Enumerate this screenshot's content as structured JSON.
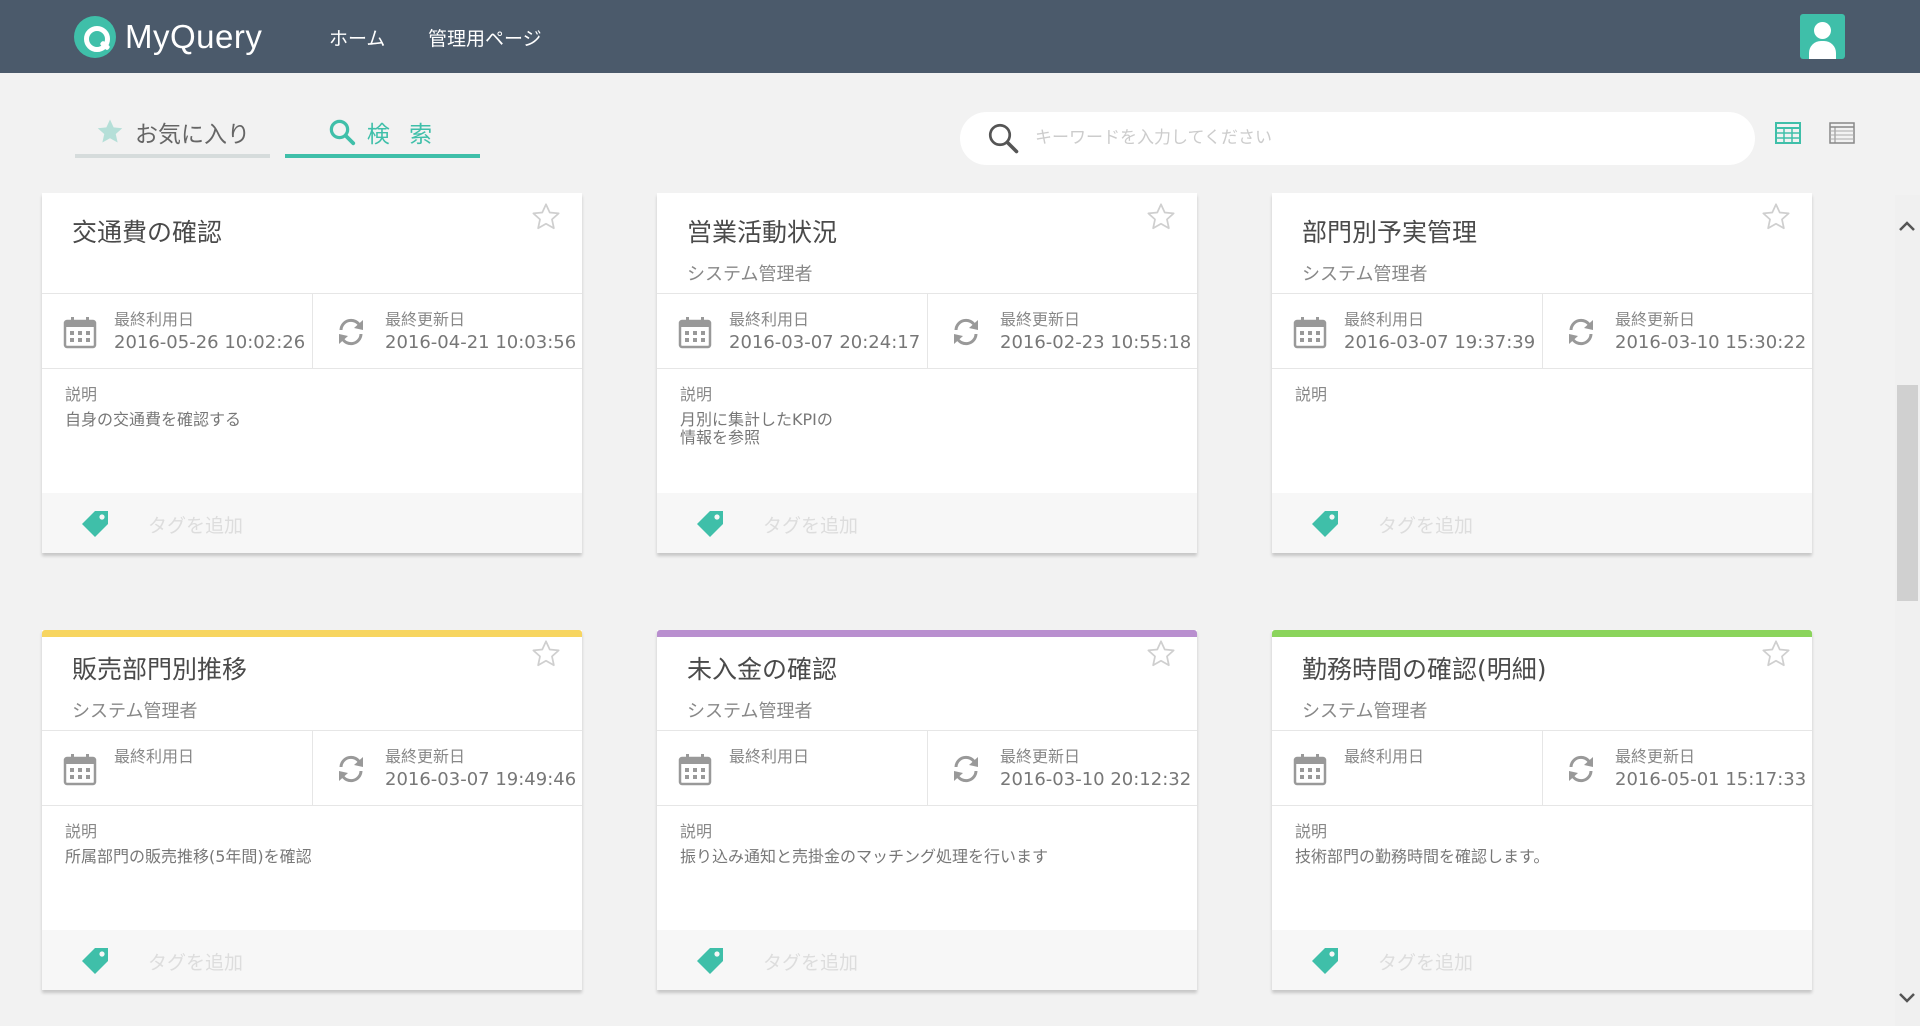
{
  "header": {
    "logo_text": "MyQuery",
    "nav": [
      {
        "label": "ホーム"
      },
      {
        "label": "管理用ページ"
      }
    ]
  },
  "tabs": [
    {
      "label": "お気に入り",
      "icon": "star-icon",
      "active": false
    },
    {
      "label": "検 索",
      "icon": "search-icon",
      "active": true
    }
  ],
  "search": {
    "placeholder": "キーワードを入力してください",
    "value": ""
  },
  "view_toggle": [
    {
      "icon": "grid-view-icon",
      "active": true
    },
    {
      "icon": "list-view-icon",
      "active": false
    }
  ],
  "labels": {
    "last_used": "最終利用日",
    "last_updated": "最終更新日",
    "description": "説明",
    "add_tag": "タグを追加"
  },
  "colors": {
    "header_bg": "#4b5a6b",
    "accent": "#3fbfa9",
    "card_accent_yellow": "#f7d560",
    "card_accent_purple": "#b98fcf",
    "card_accent_green": "#8bd45c"
  },
  "cards": [
    {
      "title": "交通費の確認",
      "owner": "",
      "last_used": "2016-05-26 10:02:26",
      "last_updated": "2016-04-21 10:03:56",
      "description": "自身の交通費を確認する",
      "accent": ""
    },
    {
      "title": "営業活動状況",
      "owner": "システム管理者",
      "last_used": "2016-03-07 20:24:17",
      "last_updated": "2016-02-23 10:55:18",
      "description": "月別に集計したKPIの\n情報を参照",
      "accent": ""
    },
    {
      "title": "部門別予実管理",
      "owner": "システム管理者",
      "last_used": "2016-03-07 19:37:39",
      "last_updated": "2016-03-10 15:30:22",
      "description": "",
      "accent": ""
    },
    {
      "title": "販売部門別推移",
      "owner": "システム管理者",
      "last_used": "",
      "last_updated": "2016-03-07 19:49:46",
      "description": "所属部門の販売推移(5年間)を確認",
      "accent": "#f7d560"
    },
    {
      "title": "未入金の確認",
      "owner": "システム管理者",
      "last_used": "",
      "last_updated": "2016-03-10 20:12:32",
      "description": "振り込み通知と売掛金のマッチング処理を行います",
      "accent": "#b98fcf"
    },
    {
      "title": "勤務時間の確認(明細)",
      "owner": "システム管理者",
      "last_used": "",
      "last_updated": "2016-05-01 15:17:33",
      "description": "技術部門の勤務時間を確認します。",
      "accent": "#8bd45c"
    }
  ]
}
